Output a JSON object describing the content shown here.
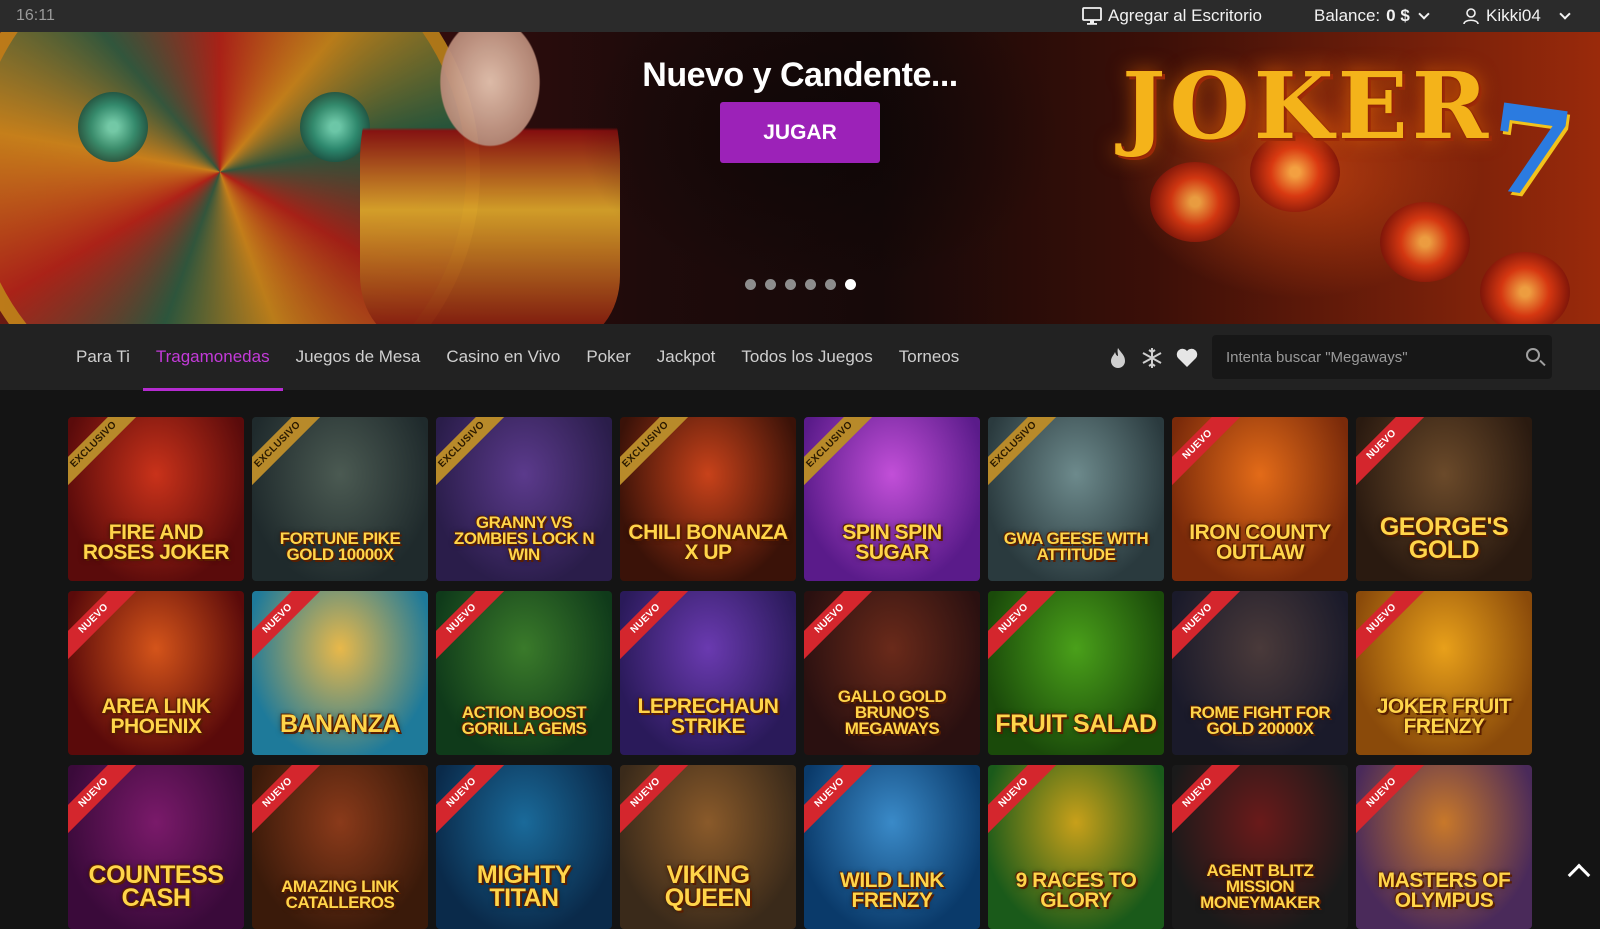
{
  "statusbar": {
    "time": "16:11"
  },
  "header": {
    "add_desktop": "Agregar al Escritorio",
    "balance_label": "Balance:",
    "balance_value": "0 $",
    "username": "Kikki04"
  },
  "hero": {
    "title": "Nuevo y Candente...",
    "play_label": "JUGAR",
    "logo_text": "JOKER",
    "slide_count": 6,
    "active_slide": 6
  },
  "nav": {
    "tabs": [
      {
        "label": "Para Ti"
      },
      {
        "label": "Tragamonedas"
      },
      {
        "label": "Juegos de Mesa"
      },
      {
        "label": "Casino en Vivo"
      },
      {
        "label": "Poker"
      },
      {
        "label": "Jackpot"
      },
      {
        "label": "Todos los Juegos"
      },
      {
        "label": "Torneos"
      }
    ],
    "active_tab": "Tragamonedas",
    "icons": [
      "fire-icon",
      "snowflake-icon",
      "heart-icon"
    ],
    "search_placeholder": "Intenta buscar \"Megaways\""
  },
  "games": [
    {
      "title": "Fire and Roses Joker",
      "badge": "EXCLUSIVO",
      "colors": [
        "#5a0b0b",
        "#c9321a"
      ]
    },
    {
      "title": "Fortune Pike Gold 10000X",
      "badge": "EXCLUSIVO",
      "colors": [
        "#1f2a2c",
        "#4b5a52"
      ]
    },
    {
      "title": "Granny vs Zombies Lock n Win",
      "badge": "EXCLUSIVO",
      "colors": [
        "#2a1d4a",
        "#5b3a8c"
      ]
    },
    {
      "title": "Chili Bonanza X Up",
      "badge": "EXCLUSIVO",
      "colors": [
        "#3a1208",
        "#c8421a"
      ]
    },
    {
      "title": "Spin Spin Sugar",
      "badge": "EXCLUSIVO",
      "colors": [
        "#5a1b8a",
        "#c24fd8"
      ]
    },
    {
      "title": "GWA Geese with Attitude",
      "badge": "EXCLUSIVO",
      "colors": [
        "#2a3a3e",
        "#6d8a8c"
      ]
    },
    {
      "title": "Iron County Outlaw",
      "badge": "NUEVO",
      "colors": [
        "#7a2a0a",
        "#e36b18"
      ]
    },
    {
      "title": "George's Gold",
      "badge": "NUEVO",
      "colors": [
        "#2a1a10",
        "#6b4a2a"
      ]
    },
    {
      "title": "Area Link Phoenix",
      "badge": "NUEVO",
      "colors": [
        "#5a0a0a",
        "#d4541a"
      ]
    },
    {
      "title": "Bananza",
      "badge": "NUEVO",
      "colors": [
        "#1e7a9a",
        "#e8b84a"
      ]
    },
    {
      "title": "Action Boost Gorilla Gems",
      "badge": "NUEVO",
      "colors": [
        "#0f3a1a",
        "#3a7a2a"
      ]
    },
    {
      "title": "Leprechaun Strike",
      "badge": "NUEVO",
      "colors": [
        "#2a1a5a",
        "#6a3ab0"
      ]
    },
    {
      "title": "Gallo Gold Bruno's Megaways",
      "badge": "NUEVO",
      "colors": [
        "#2a1010",
        "#6a2a1a"
      ]
    },
    {
      "title": "Fruit Salad",
      "badge": "NUEVO",
      "colors": [
        "#1a4a0a",
        "#4aa01a"
      ]
    },
    {
      "title": "Rome Fight for Gold 20000X",
      "badge": "NUEVO",
      "colors": [
        "#1a1a2a",
        "#4a3a3a"
      ]
    },
    {
      "title": "Joker Fruit Frenzy",
      "badge": "NUEVO",
      "colors": [
        "#8a4a0a",
        "#e8a01a"
      ]
    },
    {
      "title": "Countess Cash",
      "badge": "NUEVO",
      "colors": [
        "#3a0a3a",
        "#7a1a6a"
      ]
    },
    {
      "title": "Amazing Link Catalleros",
      "badge": "NUEVO",
      "colors": [
        "#3a1a0a",
        "#8a3a1a"
      ]
    },
    {
      "title": "Mighty Titan",
      "badge": "NUEVO",
      "colors": [
        "#0a2a4a",
        "#1a6a9a"
      ]
    },
    {
      "title": "Viking Queen",
      "badge": "NUEVO",
      "colors": [
        "#3a2a1a",
        "#8a5a2a"
      ]
    },
    {
      "title": "Wild Link Frenzy",
      "badge": "NUEVO",
      "colors": [
        "#0a3a6a",
        "#3a8ac8"
      ]
    },
    {
      "title": "9 Races to Glory",
      "badge": "NUEVO",
      "colors": [
        "#1a5a1a",
        "#c8a01a"
      ]
    },
    {
      "title": "Agent Blitz Mission Moneymaker",
      "badge": "NUEVO",
      "colors": [
        "#1a1a1a",
        "#6a1a1a"
      ]
    },
    {
      "title": "Masters of Olympus",
      "badge": "NUEVO",
      "colors": [
        "#4a2a5a",
        "#c8782a"
      ]
    }
  ]
}
